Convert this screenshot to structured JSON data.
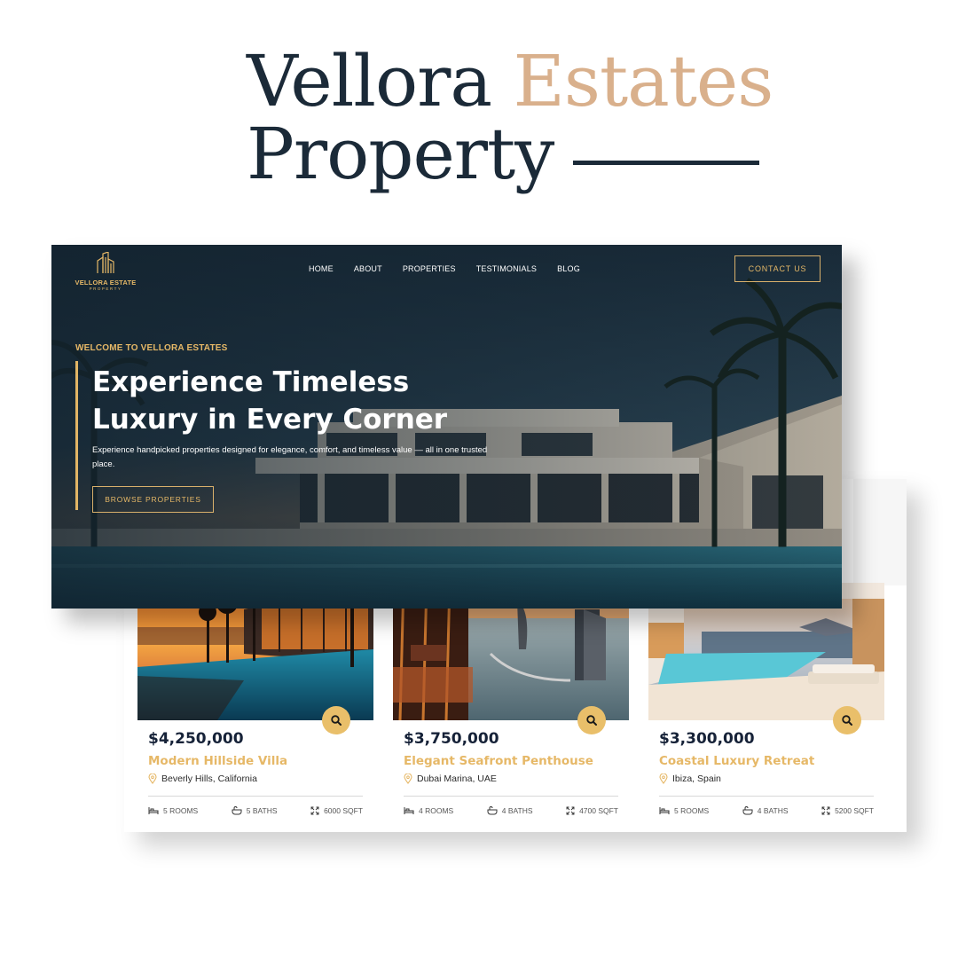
{
  "headline": {
    "line1_main": "Vellora",
    "line1_accent": "Estates",
    "line2": "Property"
  },
  "hero": {
    "logo": {
      "brand": "VELLORA ESTATE",
      "sub": "PROPERTY"
    },
    "nav": [
      "HOME",
      "ABOUT",
      "PROPERTIES",
      "TESTIMONIALS",
      "BLOG"
    ],
    "contact_label": "CONTACT US",
    "welcome": "WELCOME TO VELLORA ESTATES",
    "title_line1": "Experience Timeless",
    "title_line2": "Luxury in Every Corner",
    "paragraph": "Experience handpicked properties designed for elegance, comfort, and timeless value — all in one trusted place.",
    "browse_label": "BROWSE PROPERTIES"
  },
  "cards": [
    {
      "price": "$4,250,000",
      "title": "Modern Hillside Villa",
      "location": "Beverly Hills, California",
      "rooms": "5 ROOMS",
      "baths": "5 BATHS",
      "area": "6000 SQFT"
    },
    {
      "price": "$3,750,000",
      "title": "Elegant Seafront Penthouse",
      "location": "Dubai Marina, UAE",
      "rooms": "4 ROOMS",
      "baths": "4 BATHS",
      "area": "4700 SQFT"
    },
    {
      "price": "$3,300,000",
      "title": "Coastal Luxury Retreat",
      "location": "Ibiza, Spain",
      "rooms": "5 ROOMS",
      "baths": "4 BATHS",
      "area": "5200 SQFT"
    }
  ],
  "colors": {
    "gold": "#e6b867",
    "navy": "#1b2a38",
    "accent_serif": "#d9b08c"
  },
  "icons": [
    "search-icon",
    "location-pin-icon",
    "bed-icon",
    "bath-icon",
    "area-icon",
    "building-logo-icon"
  ]
}
